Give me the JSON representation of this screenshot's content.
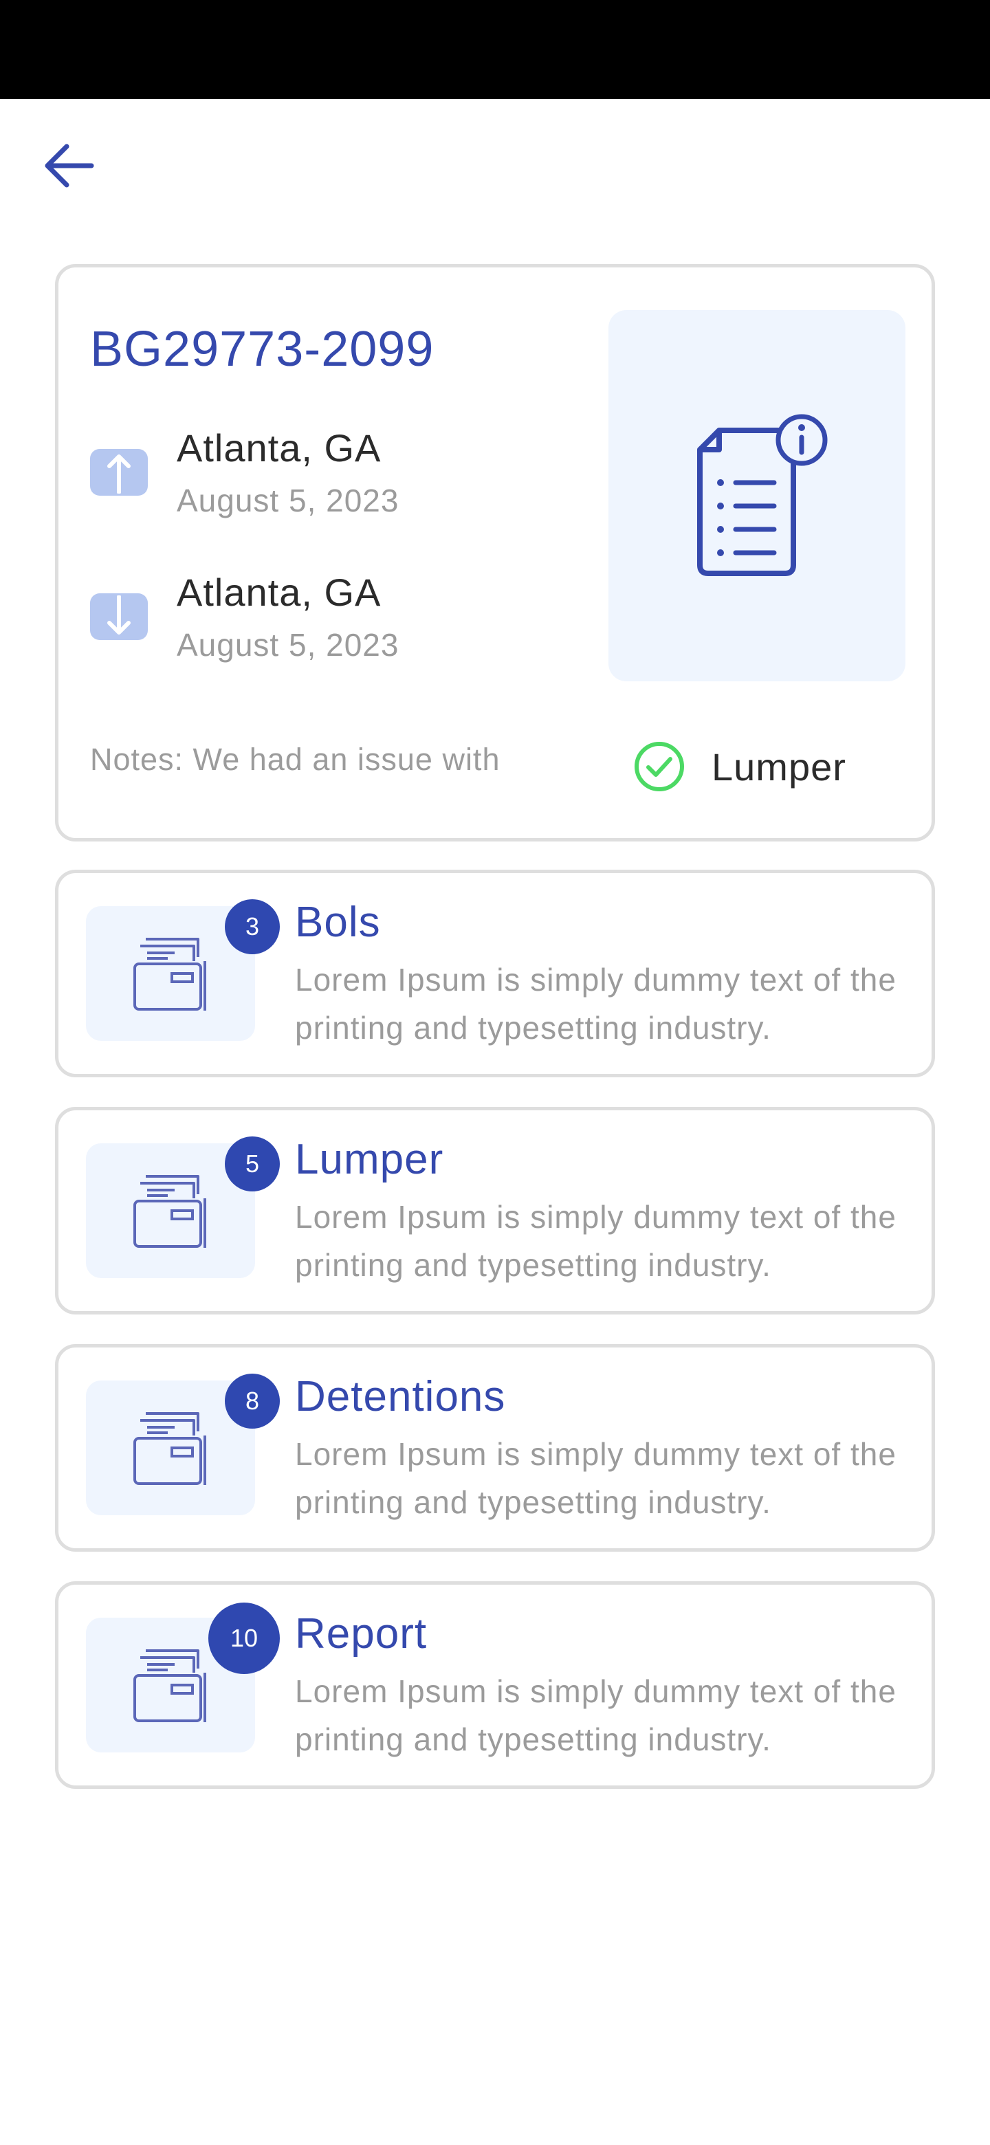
{
  "status_bar": {},
  "header": {
    "back_icon": "arrow-left-icon"
  },
  "load": {
    "id": "BG29773-2099",
    "pickup": {
      "city": "Atlanta, GA",
      "date": "August 5, 2023",
      "icon": "arrow-up-icon"
    },
    "dropoff": {
      "city": "Atlanta, GA",
      "date": "August 5, 2023",
      "icon": "arrow-down-icon"
    },
    "notes": "Notes: We had an issue with",
    "lumper_status": {
      "label": "Lumper",
      "checked": true
    },
    "preview_icon": "document-info-icon"
  },
  "documents": [
    {
      "title": "Bols",
      "count": "3",
      "description": "Lorem Ipsum is simply dummy text of the printing and typesetting industry.",
      "icon": "folder-icon"
    },
    {
      "title": "Lumper",
      "count": "5",
      "description": "Lorem Ipsum is simply dummy text of the printing and typesetting industry.",
      "icon": "folder-icon"
    },
    {
      "title": "Detentions",
      "count": "8",
      "description": "Lorem Ipsum is simply dummy text of the printing and typesetting industry.",
      "icon": "folder-icon"
    },
    {
      "title": "Report",
      "count": "10",
      "description": "Lorem Ipsum is simply dummy text of the printing and typesetting industry.",
      "icon": "folder-icon"
    }
  ],
  "colors": {
    "accent": "#3549ad",
    "badge": "#2f48b0",
    "check": "#4cd964",
    "tile_bg": "#eff5fe",
    "border": "#dedede"
  }
}
